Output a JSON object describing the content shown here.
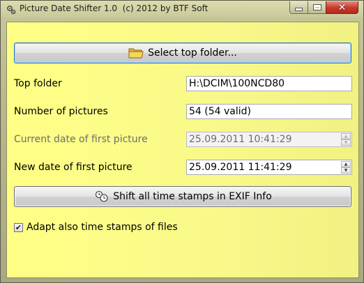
{
  "window": {
    "title": "Picture Date Shifter 1.0  (c) 2012 by BTF Soft",
    "icon": "app-gears-icon",
    "controls": [
      "minimize",
      "maximize",
      "close"
    ]
  },
  "buttons": {
    "select_folder": {
      "label": "Select top folder...",
      "icon": "folder-icon"
    },
    "shift": {
      "label": "Shift all time stamps in EXIF Info",
      "icon": "clock-icon"
    }
  },
  "fields": {
    "top_folder": {
      "label": "Top folder",
      "value": "H:\\DCIM\\100NCD80"
    },
    "num_pictures": {
      "label": "Number of pictures",
      "value": "54 (54 valid)"
    },
    "current_date": {
      "label": "Current date of first picture",
      "value": "25.09.2011 10:41:29",
      "enabled": false
    },
    "new_date": {
      "label": "New date of first picture",
      "value": "25.09.2011 11:41:29",
      "enabled": true
    }
  },
  "checkbox": {
    "label": "Adapt also time stamps of files",
    "checked": true
  },
  "colors": {
    "client_bg": "#ffff86",
    "close_red": "#c7372a",
    "focus_blue": "#2f6fb4"
  }
}
